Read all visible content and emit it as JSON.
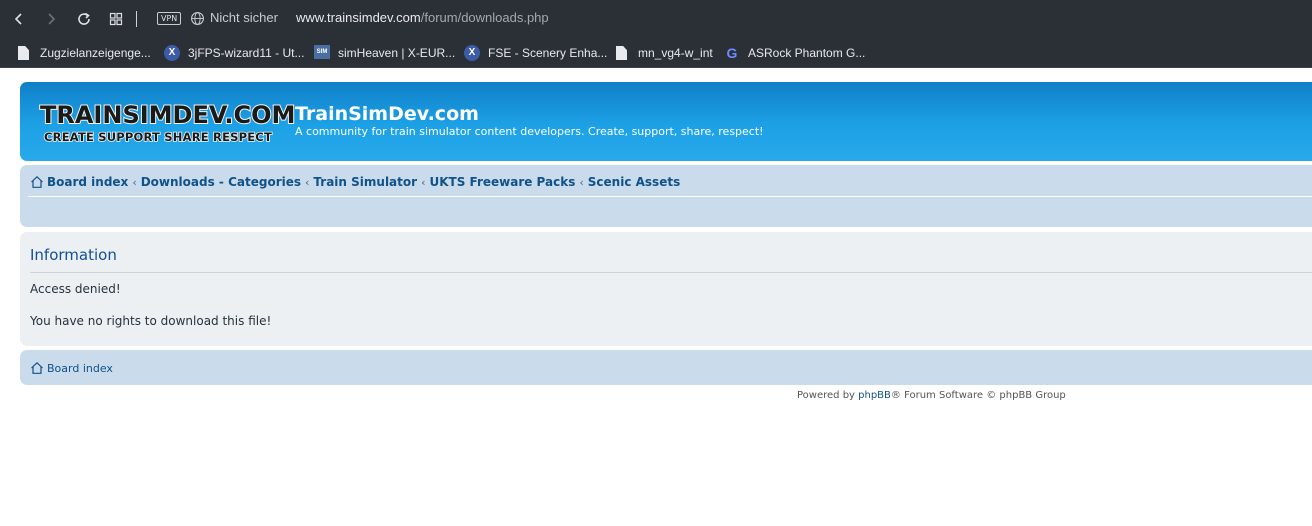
{
  "browser": {
    "vpn_label": "VPN",
    "security_label": "Nicht sicher",
    "url_host": "www.trainsimdev.com",
    "url_path": "/forum/downloads.php",
    "bookmarks": [
      {
        "label": "Zugzielanzeigenge...",
        "icon": "file-icon"
      },
      {
        "label": "3jFPS-wizard11 - Ut...",
        "icon": "xplane-icon"
      },
      {
        "label": "simHeaven | X-EUR...",
        "icon": "simheaven-icon"
      },
      {
        "label": "FSE - Scenery Enha...",
        "icon": "xplane-icon"
      },
      {
        "label": "mn_vg4-w_int",
        "icon": "file-icon"
      },
      {
        "label": "ASRock Phantom G...",
        "icon": "g-icon"
      }
    ]
  },
  "header": {
    "logo_line1": "TRAINSIMDEV.COM",
    "logo_line2": "CREATE SUPPORT SHARE RESPECT",
    "site_title": "TrainSimDev.com",
    "site_description": "A community for train simulator content developers. Create, support, share, respect!"
  },
  "breadcrumbs": [
    "Board index",
    "Downloads - Categories",
    "Train Simulator",
    "UKTS Freeware Packs",
    "Scenic Assets"
  ],
  "panel": {
    "title": "Information",
    "message1": "Access denied!",
    "message2": "You have no rights to download this file!"
  },
  "bottom_nav": {
    "board_index": "Board index"
  },
  "footer": {
    "prefix": "Powered by ",
    "link": "phpBB",
    "suffix": "® Forum Software © phpBB Group"
  },
  "colors": {
    "header_blue": "#1a9ae0",
    "nav_bg": "#cadceb",
    "panel_bg": "#ecf0f3",
    "link": "#105289"
  }
}
